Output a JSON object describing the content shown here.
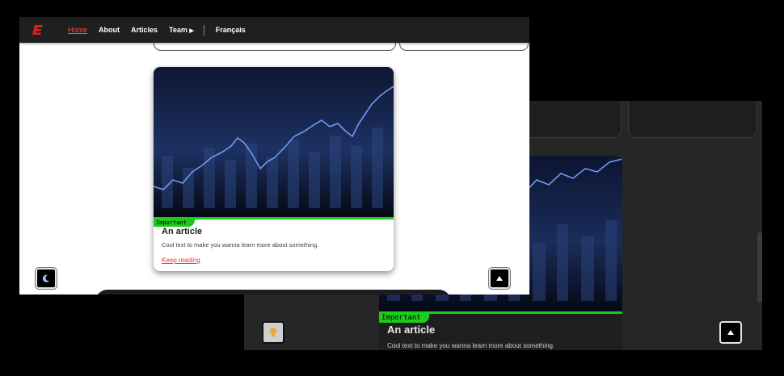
{
  "light_view": {
    "nav": {
      "links": [
        "Home",
        "About",
        "Articles",
        "Team"
      ],
      "language": "Français"
    },
    "article": {
      "tag": "Important",
      "title": "An article",
      "description": "Cool text to make you wanna learn more about something.",
      "link": "Keep reading"
    },
    "theme_toggle_icon": "moon-icon",
    "scroll_top_icon": "triangle-up-icon"
  },
  "dark_view": {
    "article": {
      "tag": "Important",
      "title": "An article",
      "description": "Cool text to make you wanna learn more about something."
    },
    "theme_toggle_icon": "lightbulb-icon",
    "scroll_top_icon": "triangle-up-icon"
  },
  "colors": {
    "accent_red": "#e23b3b",
    "tag_green": "#1bcc1b",
    "navbar_bg": "#1f1f1f",
    "dark_bg": "#262626"
  }
}
